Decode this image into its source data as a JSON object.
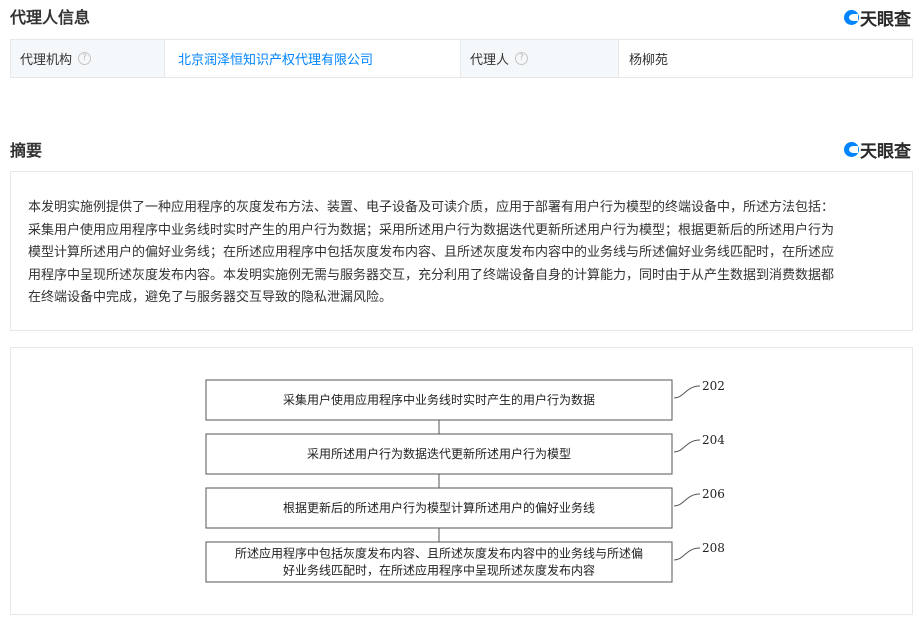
{
  "agent_section": {
    "title": "代理人信息",
    "brand": "天眼查",
    "agency_label": "代理机构",
    "agency_value": "北京润泽恒知识产权代理有限公司",
    "agent_label": "代理人",
    "agent_value": "杨柳苑",
    "help_glyph": "?"
  },
  "abstract_section": {
    "title": "摘要",
    "brand": "天眼查",
    "lines": [
      "本发明实施例提供了一种应用程序的灰度发布方法、装置、电子设备及可读介质，应用于部署有用户行为模型的终端设备中，所述方法包括：",
      "采集用户使用应用程序中业务线时实时产生的用户行为数据；采用所述用户行为数据迭代更新所述用户行为模型；根据更新后的所述用户行为",
      "模型计算所述用户的偏好业务线；在所述应用程序中包括灰度发布内容、且所述灰度发布内容中的业务线与所述偏好业务线匹配时，在所述应",
      "用程序中呈现所述灰度发布内容。本发明实施例无需与服务器交互，充分利用了终端设备自身的计算能力，同时由于从产生数据到消费数据都",
      "在终端设备中完成，避免了与服务器交互导致的隐私泄漏风险。"
    ]
  },
  "flowchart": {
    "steps": [
      {
        "number": "202",
        "lines": [
          "采集用户使用应用程序中业务线时实时产生的用户行为数据"
        ]
      },
      {
        "number": "204",
        "lines": [
          "采用所述用户行为数据迭代更新所述用户行为模型"
        ]
      },
      {
        "number": "206",
        "lines": [
          "根据更新后的所述用户行为模型计算所述用户的偏好业务线"
        ]
      },
      {
        "number": "208",
        "lines": [
          "所述应用程序中包括灰度发布内容、且所述灰度发布内容中的业务线与所述偏",
          "好业务线匹配时，在所述应用程序中呈现所述灰度发布内容"
        ]
      }
    ]
  }
}
